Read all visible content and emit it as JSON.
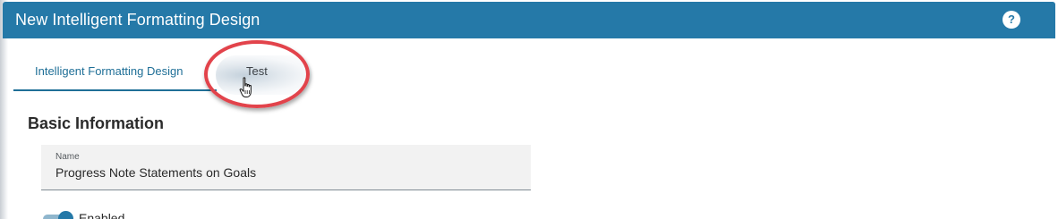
{
  "dialog": {
    "title": "New Intelligent Formatting Design",
    "help_icon": "help-circle-icon",
    "help_glyph": "?"
  },
  "tabs": [
    {
      "label": "Intelligent Formatting Design",
      "active": true
    },
    {
      "label": "Test",
      "active": false
    }
  ],
  "basic_information": {
    "heading": "Basic Information",
    "name_field": {
      "label": "Name",
      "value": "Progress Note Statements on Goals"
    },
    "enabled_toggle": {
      "label": "Enabled",
      "checked": true
    }
  },
  "colors": {
    "titlebar": "#2579a8",
    "accent": "#1f6f97",
    "annotation": "#e2434b"
  },
  "annotations": {
    "highlight": "red-ellipse-around-test-tab",
    "cursor": "hand-pointer-icon"
  }
}
